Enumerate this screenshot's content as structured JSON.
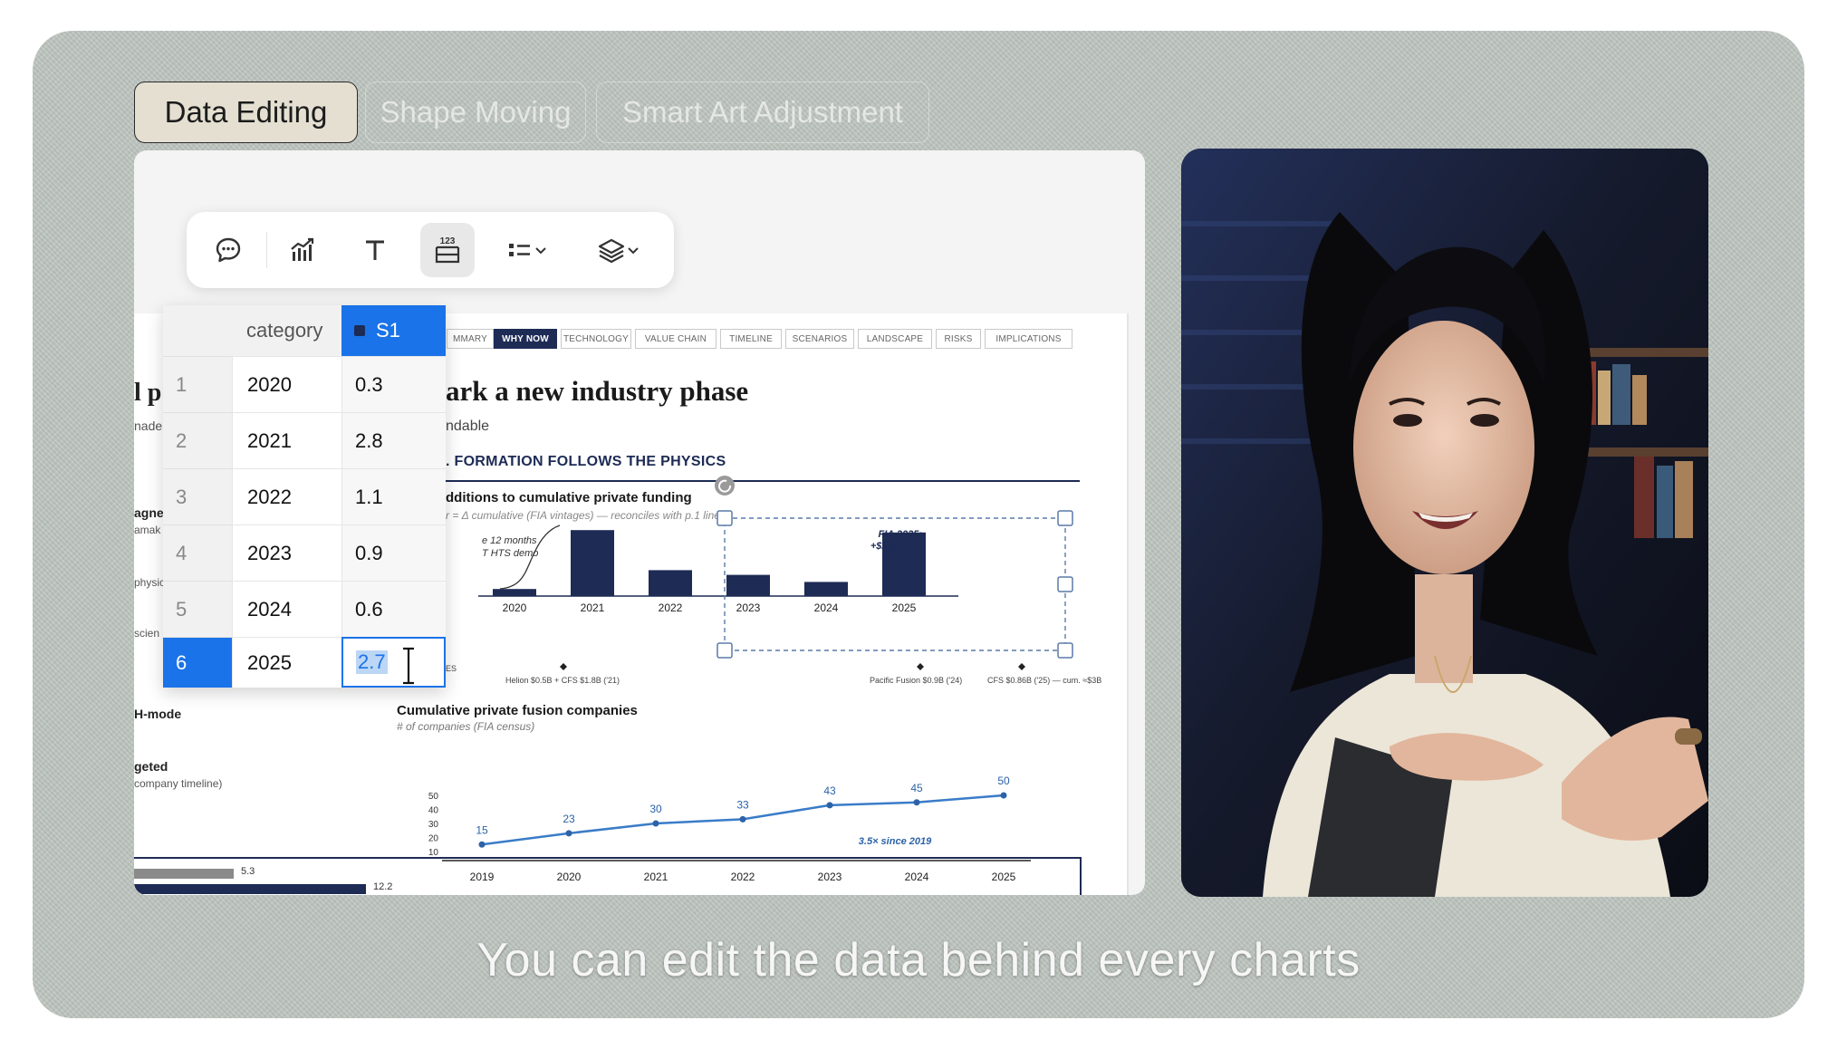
{
  "tabs": [
    {
      "label": "Data Editing",
      "active": true
    },
    {
      "label": "Shape Moving",
      "active": false
    },
    {
      "label": "Smart Art Adjustment",
      "active": false
    }
  ],
  "toolbar": {
    "buttons": [
      {
        "icon": "comment-icon"
      },
      {
        "icon": "chart-icon"
      },
      {
        "icon": "text-icon"
      },
      {
        "icon": "data-table-icon",
        "selected": true
      },
      {
        "icon": "list-dropdown-icon"
      },
      {
        "icon": "layers-dropdown-icon"
      }
    ]
  },
  "slide": {
    "nav_tabs": [
      "MMARY",
      "WHY NOW",
      "TECHNOLOGY",
      "VALUE CHAIN",
      "TIMELINE",
      "SCENARIOS",
      "LANDSCAPE",
      "RISKS",
      "IMPLICATIONS"
    ],
    "active_nav": "WHY NOW",
    "title": "ark a new industry phase",
    "subtitle": "ndable",
    "section": ". FORMATION FOLLOWS THE PHYSICS",
    "left_fragments": [
      "l p",
      "nade",
      "agne",
      "amak",
      "physic",
      "scien",
      "H-mode",
      "geted",
      "company timeline)"
    ],
    "chart1": {
      "title": "dditions to cumulative private funding",
      "note": "r = Δ cumulative (FIA vintages) — reconciles with p.1 line",
      "annotation_left": [
        "e 12 months",
        "T HTS demo"
      ],
      "annotation_right": [
        "FIA 2025:",
        "+$2.6–2.7B"
      ],
      "footnotes": [
        "SES",
        "Helion $0.5B + CFS $1.8B ('21)",
        "Pacific Fusion $0.9B ('24)",
        "CFS $0.86B ('25) — cum. ≈$3B"
      ]
    },
    "chart2": {
      "title": "Cumulative private fusion companies",
      "note": "# of companies (FIA census)",
      "annotation": "3.5× since 2019",
      "yticks": [
        "50",
        "40",
        "30",
        "20",
        "10"
      ]
    },
    "bottom_bars": [
      {
        "value_label": "5.3"
      },
      {
        "value_label": "12.2"
      }
    ]
  },
  "data_table": {
    "col_category": "category",
    "col_series": "S1",
    "rows": [
      {
        "idx": "1",
        "category": "2020",
        "value": "0.3"
      },
      {
        "idx": "2",
        "category": "2021",
        "value": "2.8"
      },
      {
        "idx": "3",
        "category": "2022",
        "value": "1.1"
      },
      {
        "idx": "4",
        "category": "2023",
        "value": "0.9"
      },
      {
        "idx": "5",
        "category": "2024",
        "value": "0.6"
      },
      {
        "idx": "6",
        "category": "2025",
        "value": "2.7"
      }
    ],
    "selected_row": 6
  },
  "chart_data": [
    {
      "type": "bar",
      "title": "dditions to cumulative private funding",
      "categories": [
        "2020",
        "2021",
        "2022",
        "2023",
        "2024",
        "2025"
      ],
      "values": [
        0.3,
        2.8,
        1.1,
        0.9,
        0.6,
        2.7
      ],
      "ylim": [
        0,
        3.0
      ],
      "color": "#1d2b55"
    },
    {
      "type": "line",
      "title": "Cumulative private fusion companies",
      "x": [
        "2019",
        "2020",
        "2021",
        "2022",
        "2023",
        "2024",
        "2025"
      ],
      "values": [
        15,
        23,
        30,
        33,
        43,
        45,
        50
      ],
      "data_labels": [
        "15",
        "23",
        "30",
        "33",
        "43",
        "45",
        "50"
      ],
      "ylim": [
        10,
        50
      ],
      "color": "#3a7cc8"
    }
  ],
  "caption": "You can edit the data behind every charts"
}
